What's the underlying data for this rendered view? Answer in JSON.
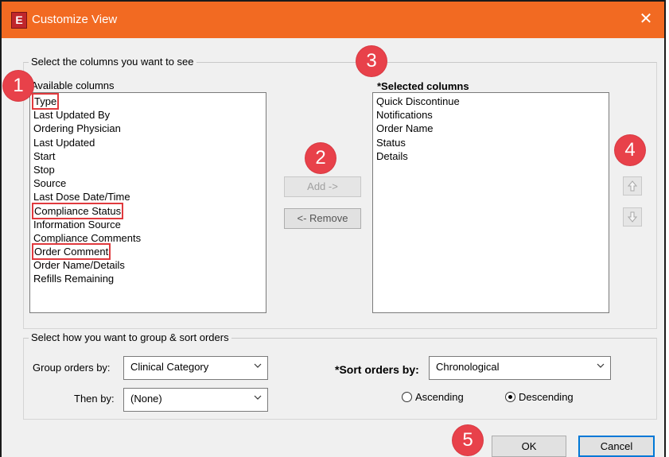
{
  "window": {
    "title": "Customize View",
    "app_icon": "E",
    "close_glyph": "✕"
  },
  "columns_group": {
    "legend": "Select the columns you want to see",
    "available_label": "Available columns",
    "available": [
      "Type",
      "Last Updated By",
      "Ordering Physician",
      "Last Updated",
      "Start",
      "Stop",
      "Source",
      "Last Dose Date/Time",
      "Compliance Status",
      "Information Source",
      "Compliance Comments",
      "Order Comment",
      "Order Name/Details",
      "Refills Remaining"
    ],
    "selected_label": "*Selected columns",
    "selected": [
      "Quick Discontinue",
      "Notifications",
      "Order Name",
      "Status",
      "Details"
    ],
    "add_label": "Add ->",
    "remove_label": "<- Remove",
    "move_up_icon": "arrow-up-icon",
    "move_down_icon": "arrow-down-icon"
  },
  "sort_group": {
    "legend": "Select how you want to group & sort orders",
    "group_by_label": "Group orders by:",
    "group_by_value": "Clinical Category",
    "then_by_label": "Then by:",
    "then_by_value": "(None)",
    "sort_by_label": "*Sort orders by:",
    "sort_by_value": "Chronological",
    "ascending_label": "Ascending",
    "descending_label": "Descending",
    "selected_order": "Descending"
  },
  "footer": {
    "ok_label": "OK",
    "cancel_label": "Cancel"
  },
  "callouts": [
    "1",
    "2",
    "3",
    "4",
    "5"
  ],
  "colors": {
    "titlebar": "#f26a22",
    "callout": "#e8414a",
    "highlight": "#e03a3e"
  }
}
